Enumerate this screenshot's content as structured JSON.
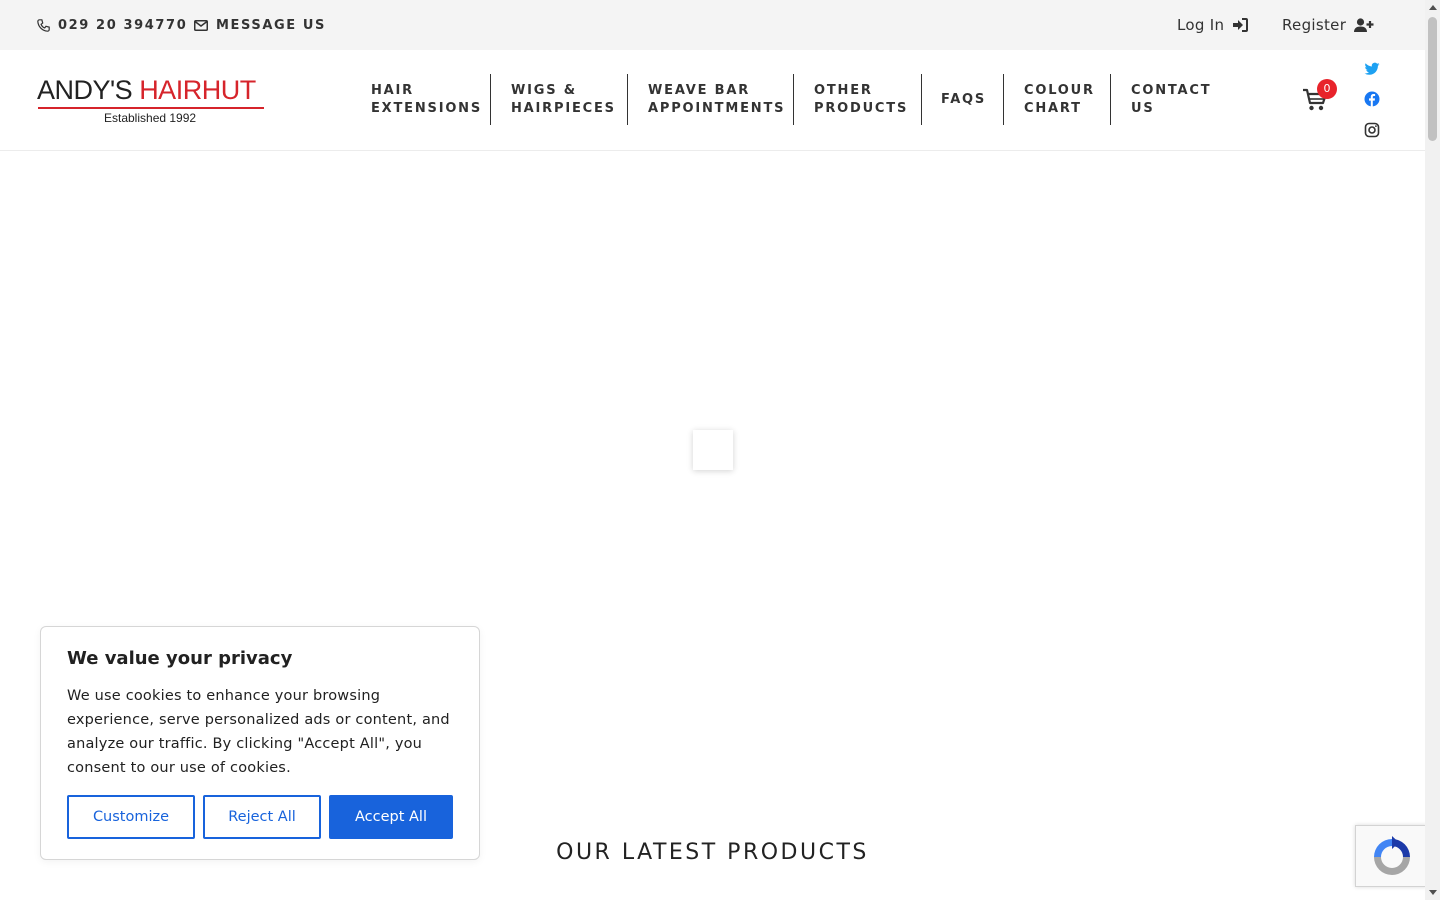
{
  "topbar": {
    "phone": "029 20 394770",
    "message": "MESSAGE US",
    "login": "Log In",
    "register": "Register"
  },
  "logo": {
    "name_dark": "ANDY'S ",
    "name_red": "HAIRHUT",
    "tagline": "Established 1992"
  },
  "nav": {
    "items": [
      {
        "line1": "HAIR",
        "line2": "EXTENSIONS"
      },
      {
        "line1": "WIGS &",
        "line2": "HAIRPIECES"
      },
      {
        "line1": "WEAVE BAR",
        "line2": "APPOINTMENTS"
      },
      {
        "line1": "OTHER",
        "line2": "PRODUCTS"
      },
      {
        "line1": "FAQS",
        "line2": ""
      },
      {
        "line1": "COLOUR",
        "line2": "CHART"
      },
      {
        "line1": "CONTACT",
        "line2": "US"
      }
    ]
  },
  "cart": {
    "count": "0"
  },
  "social": {
    "icons": [
      "twitter-icon",
      "facebook-icon",
      "instagram-icon"
    ]
  },
  "main": {
    "section_title": "OUR LATEST PRODUCTS"
  },
  "cookie": {
    "title": "We value your privacy",
    "text": "We use cookies to enhance your browsing experience, serve personalized ads or content, and analyze our traffic. By clicking \"Accept All\", you consent to our use of cookies.",
    "customize": "Customize",
    "reject": "Reject All",
    "accept": "Accept All"
  },
  "colors": {
    "brand_red": "#d6242b",
    "cookie_blue": "#1863dc",
    "twitter": "#1da1f2",
    "facebook": "#1877f2"
  }
}
